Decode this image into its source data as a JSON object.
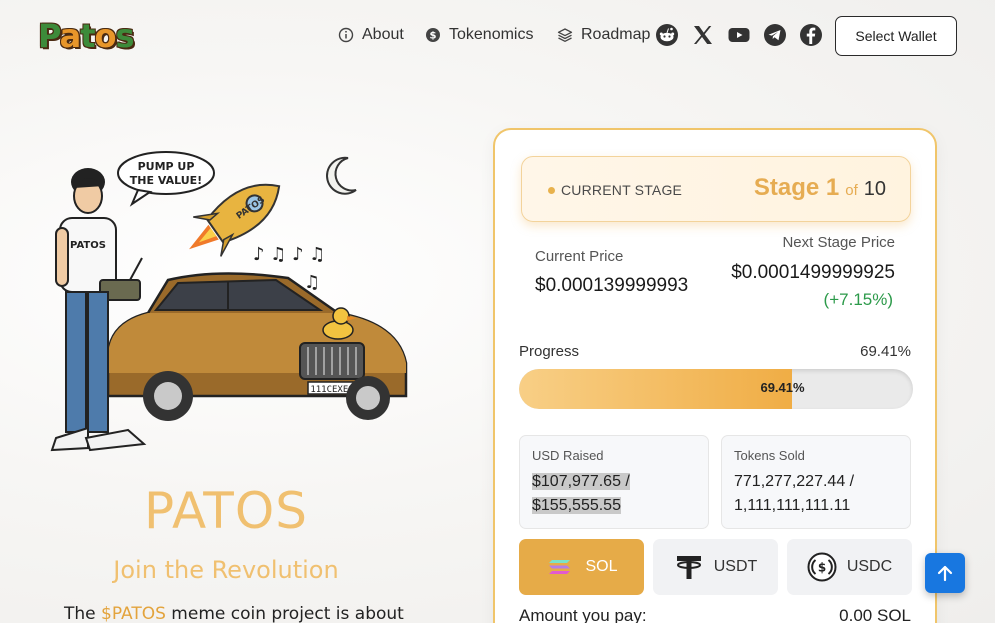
{
  "logo": {
    "text": "Patos"
  },
  "nav": {
    "links": [
      {
        "label": "About",
        "icon": "info-icon"
      },
      {
        "label": "Tokenomics",
        "icon": "dollar-icon"
      },
      {
        "label": "Roadmap",
        "icon": "layers-icon"
      }
    ],
    "socials": [
      "reddit-icon",
      "x-icon",
      "youtube-icon",
      "telegram-icon",
      "facebook-icon"
    ],
    "wallet_label": "Select Wallet"
  },
  "hero": {
    "speech": "PUMP UP THE VALUE!",
    "title": "PATOS",
    "subtitle": "Join the Revolution",
    "desc_prefix": "The ",
    "desc_highlight": "$PATOS",
    "desc_suffix": " meme coin project is about"
  },
  "presale": {
    "stage_label": "CURRENT STAGE",
    "stage_word": "Stage 1",
    "stage_of": "of",
    "stage_total": "10",
    "current_price_label": "Current Price",
    "current_price": "$0.000139999993",
    "next_price_label": "Next Stage Price",
    "next_price": "$0.0001499999925",
    "next_change": "(+7.15%)",
    "progress_label": "Progress",
    "progress_pct": "69.41%",
    "progress_value": 69.41,
    "usd_raised_label": "USD Raised",
    "usd_raised_line1": "$107,977.65 /",
    "usd_raised_line2": "$155,555.55",
    "tokens_sold_label": "Tokens Sold",
    "tokens_sold_line1": "771,277,227.44 /",
    "tokens_sold_line2": "1,111,111,111.11",
    "tokens": [
      {
        "label": "SOL",
        "icon": "solana-icon",
        "active": true
      },
      {
        "label": "USDT",
        "icon": "tether-icon",
        "active": false
      },
      {
        "label": "USDC",
        "icon": "usdc-icon",
        "active": false
      }
    ],
    "pay_label": "Amount you pay:",
    "pay_value": "0.00 SOL"
  },
  "colors": {
    "accent": "#e6ab48",
    "accent_light": "#f0c070",
    "positive": "#2c9a4a",
    "scroll_btn": "#1877e0"
  }
}
